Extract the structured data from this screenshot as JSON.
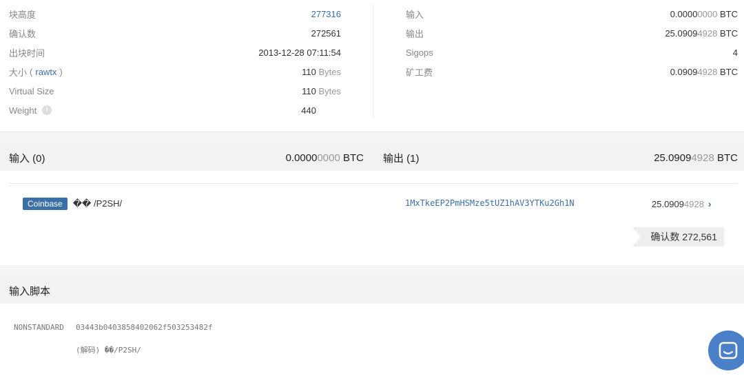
{
  "summary": {
    "left": [
      {
        "label": "块高度",
        "value": "277316"
      },
      {
        "label": "确认数",
        "value": "272561"
      },
      {
        "label": "出块时间",
        "value": "2013-12-28 07:11:54"
      },
      {
        "label": "大小",
        "label_link": "rawtx",
        "value": "110",
        "unit": "Bytes"
      },
      {
        "label": "Virtual Size",
        "value": "110",
        "unit": "Bytes"
      },
      {
        "label": "Weight",
        "value": "440"
      }
    ],
    "right": [
      {
        "label": "输入",
        "value_main": "0.0000",
        "value_dim": "0000",
        "unit": "BTC"
      },
      {
        "label": "输出",
        "value_main": "25.0909",
        "value_dim": "4928",
        "unit": "BTC"
      },
      {
        "label": "Sigops",
        "value": "4"
      },
      {
        "label": "矿工费",
        "value_main": "0.0909",
        "value_dim": "4928",
        "unit": "BTC"
      }
    ]
  },
  "io": {
    "inputs_label": "输入 (0)",
    "inputs_main": "0.0000",
    "inputs_dim": "0000",
    "inputs_unit": "BTC",
    "outputs_label": "输出 (1)",
    "outputs_main": "25.0909",
    "outputs_dim": "4928",
    "outputs_unit": "BTC",
    "coinbase_badge": "Coinbase",
    "coinbase_text": "�� /P2SH/",
    "output_address": "1MxTkeEP2PmHSMze5tUZ1hAV3YTKu2Gh1N",
    "output_amount_main": "25.0909",
    "output_amount_dim": "4928",
    "confirmations": "确认数 272,561"
  },
  "script": {
    "title": "输入脚本",
    "type": "NONSTANDARD",
    "hex": "03443b0403858402062f503253482f",
    "decoded": "(解码) ��/P2SH/"
  },
  "colors": {
    "link": "#3b6fa8",
    "badge": "#3b6fa8",
    "chat": "#4a80c8"
  },
  "icons": {
    "weight_info": "info-icon",
    "output_chevron": "chevron-right-icon",
    "chat": "chat-icon"
  }
}
